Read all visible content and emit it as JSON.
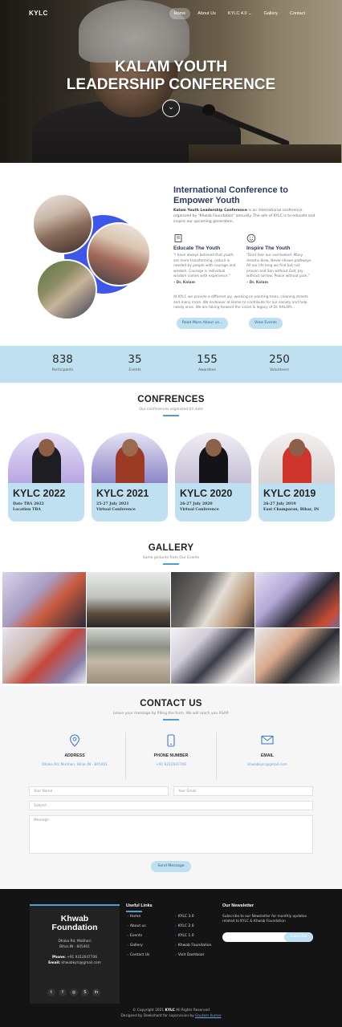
{
  "nav": {
    "logo": "KYLC",
    "items": [
      "Home",
      "About Us",
      "KYLC 4.0 ⌄",
      "Gallery",
      "Contact"
    ]
  },
  "hero": {
    "title_line1": "KALAM YOUTH",
    "title_line2": "LEADERSHIP CONFERENCE",
    "scroll_icon": "⌄"
  },
  "about": {
    "heading": "International Conference to Empower Youth",
    "intro_bold": "Kalam Youth Leadership Conference",
    "intro_rest": " is an international conference organized by \"Khwab Foundation\" annually. The aim of KYLC is to educate and inspire our upcoming generation.",
    "col1_title": "Educate The Youth",
    "col1_quote": "\"I have always believed that youth are more transforming, nature is needed by people with courage and wisdom. Courage is individual wisdom comes with experience.\"",
    "col1_author": "– Dr. Kalam",
    "col2_title": "Inspire The Youth",
    "col2_quote": "\"Dont fear our overlooked. Many dreams blow, Never-shown pathways. All our life long we find but not proven and Son without God, Joy without sorrow, Peace without pain.\"",
    "col2_author": "– Dr. Kalam",
    "outro": "At KYLC we provide a different joy, working on planting trees, cleaning streets and many more. We endeavor at Home to contribute for our society and help needy ones. We are taking forward the vision & legacy of Dr. KALAM...",
    "read_more": "Read More About us...",
    "view_events": "View Events"
  },
  "stats": [
    {
      "value": "838",
      "label": "Participants"
    },
    {
      "value": "35",
      "label": "Events"
    },
    {
      "value": "155",
      "label": "Awardees"
    },
    {
      "value": "250",
      "label": "Volunteers"
    }
  ],
  "conferences": {
    "title": "CONFRENCES",
    "subtitle": "Our conferences organized till date",
    "items": [
      {
        "year": "KYLC 2022",
        "date": "Date TBA 2022",
        "place": "Location TBA"
      },
      {
        "year": "KYLC 2021",
        "date": "25-27 July 2021",
        "place": "Virtual Conference"
      },
      {
        "year": "KYLC 2020",
        "date": "26-27 July 2020",
        "place": "Virtual Conference"
      },
      {
        "year": "KYLC 2019",
        "date": "26-27 July 2019",
        "place": "East Champaran, Bihar, IN"
      }
    ]
  },
  "gallery": {
    "title": "GALLERY",
    "subtitle": "Some pictures from Our Events"
  },
  "contact": {
    "title": "CONTACT US",
    "subtitle": "Leave your message by filling the form. We will reach you ASAP.",
    "address_title": "ADDRESS",
    "address_value": "Dhaka Rd, Motihari, Bihar,IN - 845401",
    "phone_title": "PHONE NUMBER",
    "phone_value": "+91 9312647706",
    "email_title": "EMAIL",
    "email_value": "khwabkylc@gmail.com",
    "name_placeholder": "Your Name",
    "email_placeholder": "Your Email",
    "subject_placeholder": "Subject",
    "message_placeholder": "Message",
    "send": "Send Message"
  },
  "footer": {
    "org_line1": "Khwab",
    "org_line2": "Foundation",
    "addr_line1": "Dhaka Rd, Motihari",
    "addr_line2": "Bihar,IN - 845401",
    "phone_label": "Phone:",
    "phone": "+91 9312647706",
    "email_label": "Email:",
    "email": "khwabkylc@gmail.com",
    "social_icons": [
      "twitter-icon",
      "facebook-icon",
      "instagram-icon",
      "skype-icon",
      "linkedin-icon"
    ],
    "social_glyphs": [
      "t",
      "f",
      "◎",
      "S",
      "in"
    ],
    "links_title": "Useful Links",
    "links_col1": [
      "Home",
      "About us",
      "Events",
      "Gallery",
      "Contact Us"
    ],
    "links_col2": [
      "KYLC 3.0",
      "KYLC 2.0",
      "KYLC 1.0",
      "Khwab Foundation",
      "Visit Dashboar"
    ],
    "newsletter_title": "Our Newsletter",
    "newsletter_text": "Subscribe to our Newsletter for monthly updates related to KYLC & Khwab Foundation",
    "subscribe": "Subscribe",
    "copyright_pre": "© Copyright 2021 ",
    "copyright_bold": "KYLC",
    "copyright_post": " All Rights Reserved",
    "designed_pre": "Designed by ",
    "designed_name": "Deekshant",
    "designed_mid": " for supervision by ",
    "designed_link": "Gautam Kumar"
  }
}
